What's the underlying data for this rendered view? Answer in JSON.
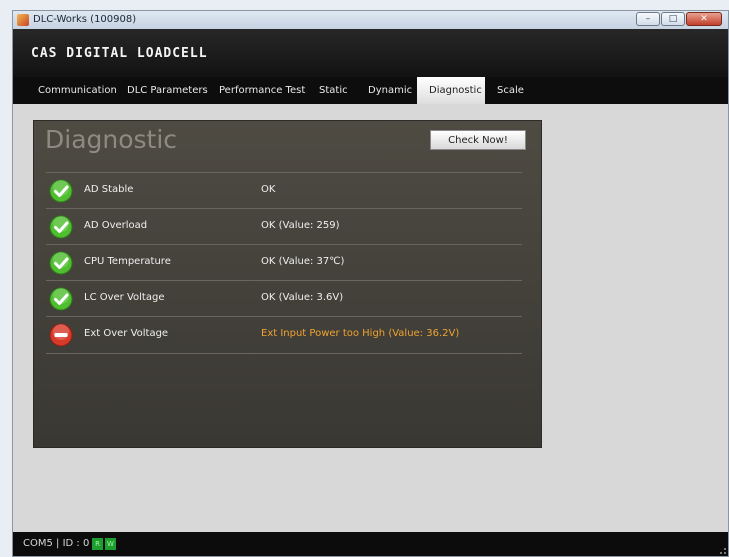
{
  "window": {
    "title": "DLC-Works (100908)"
  },
  "header": {
    "brand": "CAS DIGITAL LOADCELL"
  },
  "tabs": [
    {
      "label": "Communication",
      "active": false
    },
    {
      "label": "DLC Parameters",
      "active": false
    },
    {
      "label": "Performance Test",
      "active": false
    },
    {
      "label": "Static",
      "active": false
    },
    {
      "label": "Dynamic",
      "active": false
    },
    {
      "label": "Diagnostic",
      "active": true
    },
    {
      "label": "Scale",
      "active": false
    }
  ],
  "diagnostic": {
    "title": "Diagnostic",
    "check_button": "Check Now!",
    "rows": [
      {
        "label": "AD Stable",
        "value": "OK",
        "status": "ok",
        "icon": "check-icon"
      },
      {
        "label": "AD Overload",
        "value": "OK (Value: 259)",
        "status": "ok",
        "icon": "check-icon"
      },
      {
        "label": "CPU Temperature",
        "value": "OK (Value: 37℃)",
        "status": "ok",
        "icon": "check-icon"
      },
      {
        "label": "LC Over Voltage",
        "value": "OK (Value: 3.6V)",
        "status": "ok",
        "icon": "check-icon"
      },
      {
        "label": "Ext Over Voltage",
        "value": "Ext Input Power too High  (Value: 36.2V)",
        "status": "error",
        "icon": "minus-icon"
      }
    ]
  },
  "statusbar": {
    "text": "COM5 | ID : 0",
    "indicators": [
      "R",
      "W"
    ]
  },
  "colors": {
    "ok_icon": "#4fbf2f",
    "error_icon": "#d83a2a",
    "warning_text": "#f0a233",
    "indicator": "#1d9e2e"
  }
}
